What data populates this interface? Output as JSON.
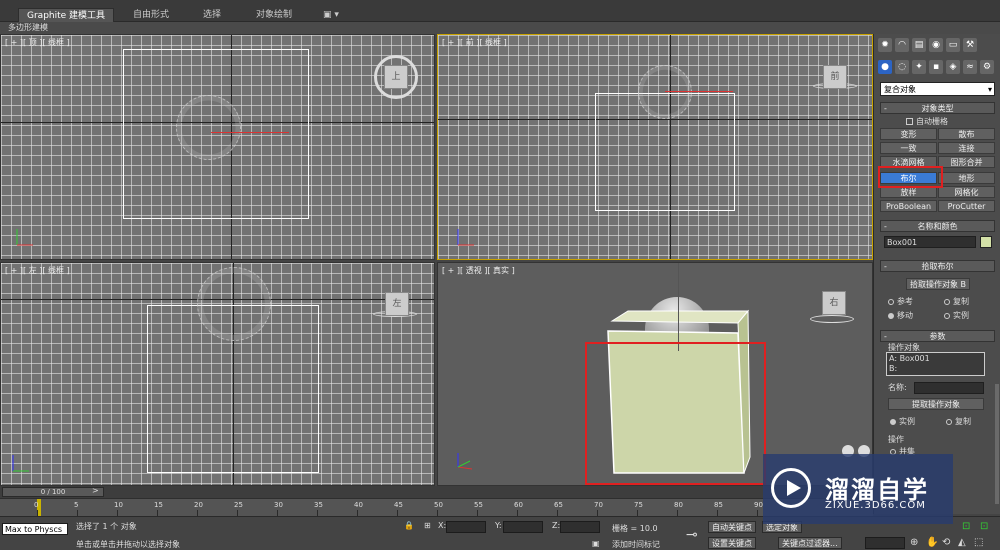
{
  "ribbon": {
    "tabs": [
      "Graphite 建模工具",
      "自由形式",
      "选择",
      "对象绘制"
    ],
    "sub_label": "多边形建模"
  },
  "viewports": {
    "top": {
      "label": "[ + ][ 顶 ][ 线框 ]",
      "gizmo": "上"
    },
    "front": {
      "label": "[ + ][ 前 ][ 线框 ]",
      "gizmo": "前"
    },
    "left": {
      "label": "[ + ][ 左 ][ 线框 ]",
      "gizmo": "左"
    },
    "perspective": {
      "label": "[ + ][ 透视 ][ 真实 ]",
      "gizmo": "右"
    }
  },
  "command_panel": {
    "category_dropdown": "复合对象",
    "object_type": {
      "title": "对象类型",
      "auto_grid": "自动栅格",
      "buttons": [
        "变形",
        "散布",
        "一致",
        "连接",
        "水滴网格",
        "图形合并",
        "布尔",
        "地形",
        "放样",
        "网格化",
        "ProBoolean",
        "ProCutter"
      ]
    },
    "name_color": {
      "title": "名称和颜色",
      "name": "Box001",
      "swatch_color": "#d4e1a8"
    },
    "pick_boolean": {
      "title": "拾取布尔",
      "pick_button": "拾取操作对象 B",
      "options": [
        "参考",
        "复制",
        "移动",
        "实例"
      ],
      "selected": "移动"
    },
    "parameters": {
      "title": "参数",
      "operands_label": "操作对象",
      "operand_a": "A: Box001",
      "operand_b": "B:",
      "name_label": "名称:",
      "extract_button": "提取操作对象",
      "instance": "实例",
      "copy": "复制",
      "operation_label": "操作",
      "union": "并集"
    }
  },
  "timeline": {
    "slider_label": "0 / 100",
    "ticks": [
      "0",
      "5",
      "10",
      "15",
      "20",
      "25",
      "30",
      "35",
      "40",
      "45",
      "50",
      "55",
      "60",
      "65",
      "70",
      "75",
      "80",
      "85",
      "90"
    ]
  },
  "status": {
    "script_label": "Max to Physcs",
    "message1": "选择了 1 个 对象",
    "message2": "单击或单击并拖动以选择对象",
    "x_label": "X:",
    "y_label": "Y:",
    "z_label": "Z:",
    "grid": "栅格 = 10.0",
    "auto_key": "自动关键点",
    "set_key": "设置关键点",
    "add_time_tag": "添加时间标记",
    "selected": "选定对象",
    "key_filter": "关键点过滤器..."
  },
  "watermark": {
    "title": "溜溜自学",
    "subtitle": "ZIXUE.3D66.COM"
  },
  "colors": {
    "highlight_red": "#e02020",
    "active_viewport": "#c8a200",
    "selected_button": "#3a7bd5"
  }
}
